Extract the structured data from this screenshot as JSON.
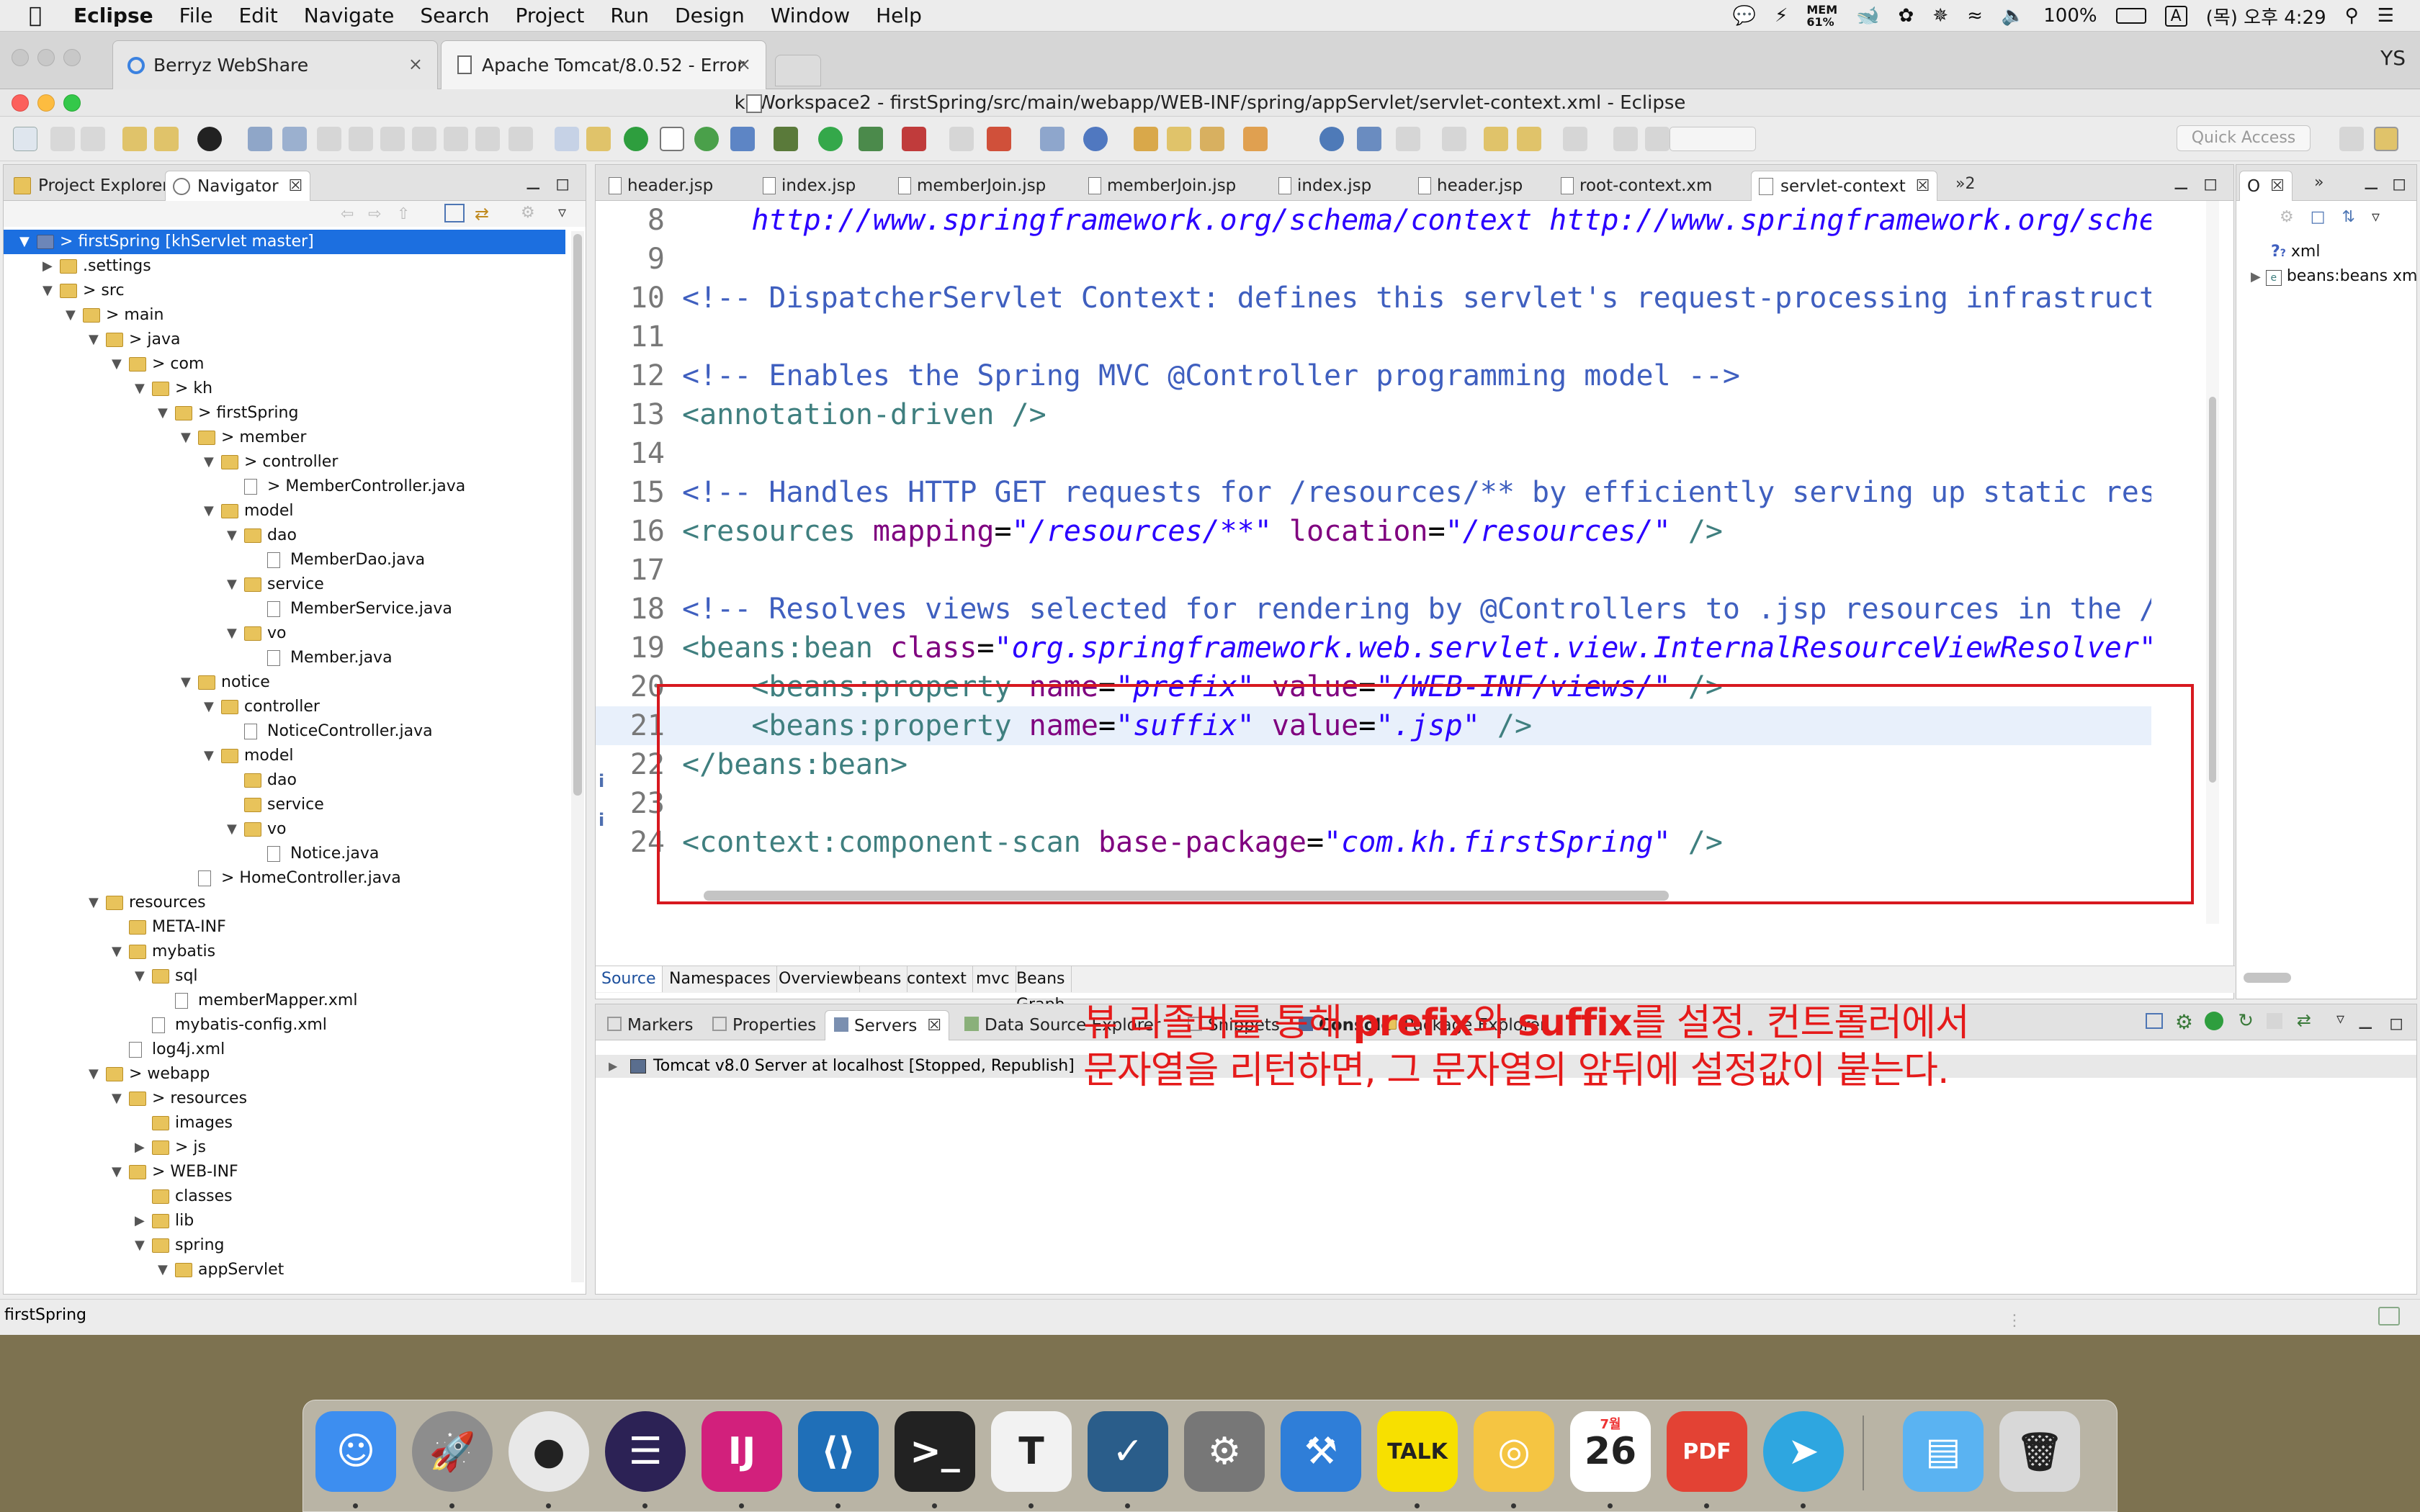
{
  "menubar": {
    "app": "Eclipse",
    "items": [
      "File",
      "Edit",
      "Navigate",
      "Search",
      "Project",
      "Run",
      "Design",
      "Window",
      "Help"
    ],
    "status_mem_label": "MEM",
    "status_mem_value": "61%",
    "battery": "100%",
    "input_mode": "A",
    "datetime": "(목) 오후 4:29"
  },
  "browser": {
    "tabs": [
      {
        "title": "Berryz WebShare",
        "close": "×"
      },
      {
        "title": "Apache Tomcat/8.0.52 - Error",
        "close": "×"
      }
    ],
    "profile": "YS"
  },
  "window": {
    "title": "khWorkspace2 - firstSpring/src/main/webapp/WEB-INF/spring/appServlet/servlet-context.xml - Eclipse",
    "quick_access_placeholder": "Quick Access"
  },
  "left_panel": {
    "tabs": [
      "Project Explorer",
      "Navigator"
    ],
    "close": "☒",
    "tree": [
      {
        "label": "> firstSpring [khServlet master]",
        "depth": 0,
        "type": "project",
        "arrow": "▼",
        "selected": true
      },
      {
        "label": ".settings",
        "depth": 1,
        "type": "folder",
        "arrow": "▶"
      },
      {
        "label": "> src",
        "depth": 1,
        "type": "folder",
        "arrow": "▼"
      },
      {
        "label": "> main",
        "depth": 2,
        "type": "folder",
        "arrow": "▼"
      },
      {
        "label": "> java",
        "depth": 3,
        "type": "folder",
        "arrow": "▼"
      },
      {
        "label": "> com",
        "depth": 4,
        "type": "folder",
        "arrow": "▼"
      },
      {
        "label": "> kh",
        "depth": 5,
        "type": "folder",
        "arrow": "▼"
      },
      {
        "label": "> firstSpring",
        "depth": 6,
        "type": "folder",
        "arrow": "▼"
      },
      {
        "label": "> member",
        "depth": 7,
        "type": "folder",
        "arrow": "▼"
      },
      {
        "label": "> controller",
        "depth": 8,
        "type": "folder",
        "arrow": "▼"
      },
      {
        "label": "> MemberController.java",
        "depth": 9,
        "type": "java",
        "arrow": ""
      },
      {
        "label": "model",
        "depth": 8,
        "type": "folder",
        "arrow": "▼"
      },
      {
        "label": "dao",
        "depth": 9,
        "type": "folder",
        "arrow": "▼"
      },
      {
        "label": "MemberDao.java",
        "depth": 10,
        "type": "java",
        "arrow": ""
      },
      {
        "label": "service",
        "depth": 9,
        "type": "folder",
        "arrow": "▼"
      },
      {
        "label": "MemberService.java",
        "depth": 10,
        "type": "java",
        "arrow": ""
      },
      {
        "label": "vo",
        "depth": 9,
        "type": "folder",
        "arrow": "▼"
      },
      {
        "label": "Member.java",
        "depth": 10,
        "type": "java",
        "arrow": ""
      },
      {
        "label": "notice",
        "depth": 7,
        "type": "folder",
        "arrow": "▼"
      },
      {
        "label": "controller",
        "depth": 8,
        "type": "folder",
        "arrow": "▼"
      },
      {
        "label": "NoticeController.java",
        "depth": 9,
        "type": "java",
        "arrow": ""
      },
      {
        "label": "model",
        "depth": 8,
        "type": "folder",
        "arrow": "▼"
      },
      {
        "label": "dao",
        "depth": 9,
        "type": "folder",
        "arrow": ""
      },
      {
        "label": "service",
        "depth": 9,
        "type": "folder",
        "arrow": ""
      },
      {
        "label": "vo",
        "depth": 9,
        "type": "folder",
        "arrow": "▼"
      },
      {
        "label": "Notice.java",
        "depth": 10,
        "type": "java",
        "arrow": ""
      },
      {
        "label": "> HomeController.java",
        "depth": 7,
        "type": "java",
        "arrow": ""
      },
      {
        "label": "resources",
        "depth": 3,
        "type": "folder",
        "arrow": "▼"
      },
      {
        "label": "META-INF",
        "depth": 4,
        "type": "folder",
        "arrow": ""
      },
      {
        "label": "mybatis",
        "depth": 4,
        "type": "folder",
        "arrow": "▼"
      },
      {
        "label": "sql",
        "depth": 5,
        "type": "folder",
        "arrow": "▼"
      },
      {
        "label": "memberMapper.xml",
        "depth": 6,
        "type": "xml",
        "arrow": ""
      },
      {
        "label": "mybatis-config.xml",
        "depth": 5,
        "type": "xml",
        "arrow": ""
      },
      {
        "label": "log4j.xml",
        "depth": 4,
        "type": "xml",
        "arrow": ""
      },
      {
        "label": "> webapp",
        "depth": 3,
        "type": "folder",
        "arrow": "▼"
      },
      {
        "label": "> resources",
        "depth": 4,
        "type": "folder",
        "arrow": "▼"
      },
      {
        "label": "images",
        "depth": 5,
        "type": "folder",
        "arrow": ""
      },
      {
        "label": "> js",
        "depth": 5,
        "type": "folder",
        "arrow": "▶"
      },
      {
        "label": "> WEB-INF",
        "depth": 4,
        "type": "folder",
        "arrow": "▼"
      },
      {
        "label": "classes",
        "depth": 5,
        "type": "folder",
        "arrow": ""
      },
      {
        "label": "lib",
        "depth": 5,
        "type": "folder",
        "arrow": "▶"
      },
      {
        "label": "spring",
        "depth": 5,
        "type": "folder",
        "arrow": "▼"
      },
      {
        "label": "appServlet",
        "depth": 6,
        "type": "folder",
        "arrow": "▼"
      }
    ]
  },
  "status_bar": {
    "text": "firstSpring"
  },
  "editor": {
    "tabs": [
      "header.jsp",
      "index.jsp",
      "memberJoin.jsp",
      "memberJoin.jsp",
      "index.jsp",
      "header.jsp",
      "root-context.xm",
      "servlet-context"
    ],
    "active_tab": "servlet-context",
    "overflow_tabs": "»2",
    "lines": [
      {
        "n": "8",
        "spans": [
          [
            "plain",
            "    "
          ],
          [
            "val",
            "http://www.springframework.org/schema/context http://www.springframework.org/schema"
          ]
        ]
      },
      {
        "n": "9",
        "spans": []
      },
      {
        "n": "10",
        "spans": [
          [
            "cmt",
            "<!-- DispatcherServlet Context: defines this servlet's request-processing infrastructur"
          ]
        ]
      },
      {
        "n": "11",
        "spans": []
      },
      {
        "n": "12",
        "spans": [
          [
            "cmt",
            "<!-- Enables the Spring MVC @Controller programming model -->"
          ]
        ]
      },
      {
        "n": "13",
        "spans": [
          [
            "tag",
            "<annotation-driven />"
          ]
        ]
      },
      {
        "n": "14",
        "spans": []
      },
      {
        "n": "15",
        "spans": [
          [
            "cmt",
            "<!-- Handles HTTP GET requests for /resources/** by efficiently serving up static resou"
          ]
        ]
      },
      {
        "n": "16",
        "spans": [
          [
            "tag",
            "<resources "
          ],
          [
            "attr",
            "mapping"
          ],
          [
            "plain",
            "="
          ],
          [
            "val",
            "\"/resources/**\""
          ],
          [
            "plain",
            " "
          ],
          [
            "attr",
            "location"
          ],
          [
            "plain",
            "="
          ],
          [
            "val",
            "\"/resources/\""
          ],
          [
            "tag",
            " />"
          ]
        ]
      },
      {
        "n": "17",
        "spans": []
      },
      {
        "n": "18",
        "spans": [
          [
            "cmt",
            "<!-- Resolves views selected for rendering by @Controllers to .jsp resources in the /WE"
          ]
        ]
      },
      {
        "n": "19",
        "spans": [
          [
            "tag",
            "<beans:bean "
          ],
          [
            "attr",
            "class"
          ],
          [
            "plain",
            "="
          ],
          [
            "val",
            "\"org.springframework.web.servlet.view.InternalResourceViewResolver\""
          ],
          [
            "tag",
            ">"
          ]
        ]
      },
      {
        "n": "20",
        "spans": [
          [
            "plain",
            "    "
          ],
          [
            "tag",
            "<beans:property "
          ],
          [
            "attr",
            "name"
          ],
          [
            "plain",
            "="
          ],
          [
            "val",
            "\"prefix\""
          ],
          [
            "plain",
            " "
          ],
          [
            "attr",
            "value"
          ],
          [
            "plain",
            "="
          ],
          [
            "val",
            "\"/WEB-INF/views/\""
          ],
          [
            "tag",
            " />"
          ]
        ]
      },
      {
        "n": "21",
        "spans": [
          [
            "plain",
            "    "
          ],
          [
            "tag",
            "<beans:property "
          ],
          [
            "attr",
            "name"
          ],
          [
            "plain",
            "="
          ],
          [
            "val",
            "\"suffix\""
          ],
          [
            "plain",
            " "
          ],
          [
            "attr",
            "value"
          ],
          [
            "plain",
            "="
          ],
          [
            "val",
            "\".jsp\""
          ],
          [
            "tag",
            " />"
          ]
        ]
      },
      {
        "n": "22",
        "spans": [
          [
            "tag",
            "</beans:bean>"
          ]
        ]
      },
      {
        "n": "23",
        "spans": []
      },
      {
        "n": "24",
        "spans": [
          [
            "tag",
            "<context:component-scan "
          ],
          [
            "attr",
            "base-package"
          ],
          [
            "plain",
            "="
          ],
          [
            "val",
            "\"com.kh.firstSpring\""
          ],
          [
            "tag",
            " />"
          ]
        ]
      }
    ],
    "source_tabs": [
      "Source",
      "Namespaces",
      "Overview",
      "beans",
      "context",
      "mvc",
      "Beans Graph"
    ],
    "active_source_tab": "Source"
  },
  "outline": {
    "tab": "O",
    "close": "☒",
    "items": [
      {
        "label": "xml",
        "prefix": "?"
      },
      {
        "label": "beans:beans xm",
        "prefix": "e"
      }
    ]
  },
  "bottom_panel": {
    "tabs": [
      "Markers",
      "Properties",
      "Servers",
      "Data Source Explorer",
      "Snippets",
      "Console",
      "Package Explorer"
    ],
    "active_tab": "Servers",
    "server_row": "Tomcat v8.0 Server at localhost  [Stopped, Republish]"
  },
  "annotation": {
    "line1_a": "뷰 리졸버를 통해 ",
    "line1_b": "prefix",
    "line1_c": "와 ",
    "line1_d": "suffix",
    "line1_e": "를 설정. 컨트롤러에서",
    "line2": "문자열을 리턴하면, 그 문자열의 앞뒤에 설정값이 붙는다."
  },
  "dock": {
    "apps": [
      {
        "name": "finder",
        "color": "#3d8ef0",
        "glyph": "☺"
      },
      {
        "name": "launchpad",
        "color": "#8d8d8d",
        "glyph": "🚀"
      },
      {
        "name": "chrome",
        "color": "#e8e8e8",
        "glyph": "●"
      },
      {
        "name": "eclipse",
        "color": "#2c2255",
        "glyph": "☰"
      },
      {
        "name": "intellij",
        "color": "#d2207c",
        "glyph": "IJ"
      },
      {
        "name": "vscode",
        "color": "#1f6fb8",
        "glyph": "⟨⟩"
      },
      {
        "name": "terminal",
        "color": "#222222",
        "glyph": ">_"
      },
      {
        "name": "typora",
        "color": "#f2f2f2",
        "glyph": "T"
      },
      {
        "name": "shield",
        "color": "#2a5d8a",
        "glyph": "✓"
      },
      {
        "name": "system-preferences",
        "color": "#777777",
        "glyph": "⚙"
      },
      {
        "name": "xcode",
        "color": "#2f7ed8",
        "glyph": "⚒"
      },
      {
        "name": "kakaotalk",
        "color": "#f7e000",
        "glyph": "TALK"
      },
      {
        "name": "lightbulb",
        "color": "#f5c542",
        "glyph": "◎"
      },
      {
        "name": "calendar",
        "color": "#ffffff",
        "glyph": "26"
      },
      {
        "name": "pdf-expert",
        "color": "#e34234",
        "glyph": "PDF"
      },
      {
        "name": "telegram",
        "color": "#2ea6e0",
        "glyph": "➤"
      },
      {
        "name": "downloads-folder",
        "color": "#5ab3f2",
        "glyph": "▤"
      },
      {
        "name": "trash",
        "color": "#d8d8d8",
        "glyph": "🗑"
      }
    ],
    "calendar_month": "7월"
  },
  "colors": {
    "selection": "#1c6fe0",
    "highlight_box": "#d7191f",
    "comment": "#3f5fbf",
    "tag": "#3f7f7f",
    "attribute": "#7f007f",
    "value": "#2a00ff",
    "annotation": "#e51a1a"
  }
}
